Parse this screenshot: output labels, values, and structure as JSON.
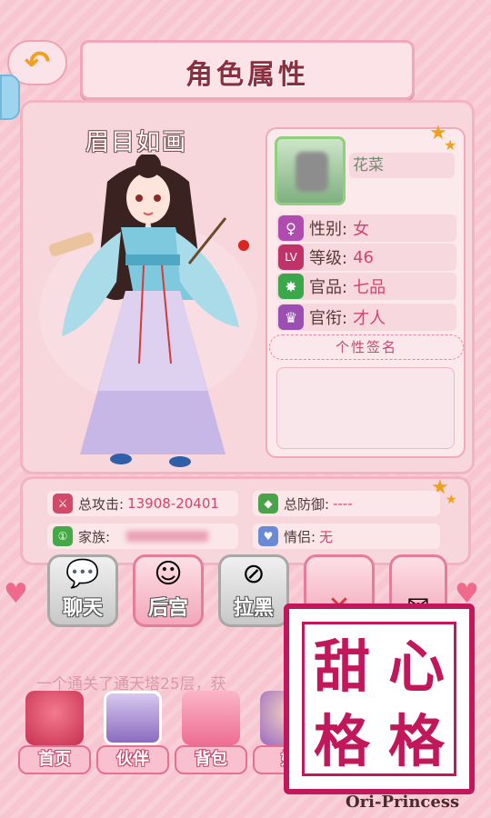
{
  "header": {
    "title": "角色属性"
  },
  "character": {
    "name": "眉目如画"
  },
  "profile": {
    "nickname": "花菜",
    "gender_label": "性别:",
    "gender_value": "女",
    "level_label": "等级:",
    "level_value": "46",
    "rank_label": "官品:",
    "rank_value": "七品",
    "title_label": "官衔:",
    "title_value": "才人",
    "signature_header": "个性签名",
    "signature": ""
  },
  "stats": {
    "attack_label": "总攻击:",
    "attack_value": "13908-20401",
    "defense_label": "总防御:",
    "defense_value": "----",
    "family_label": "家族:",
    "family_value": "",
    "partner_label": "情侣:",
    "partner_value": "无"
  },
  "actions": [
    {
      "label": "聊天"
    },
    {
      "label": "后宫"
    },
    {
      "label": "拉黑"
    }
  ],
  "marquee": "一个通关了通天塔25层，获",
  "bottom_nav": [
    {
      "label": "首页"
    },
    {
      "label": "伙伴"
    },
    {
      "label": "背包"
    },
    {
      "label": "好"
    }
  ],
  "watermark": {
    "chars": [
      "甜",
      "心",
      "格",
      "格"
    ],
    "subtitle": "Ori-Princess"
  },
  "colors": {
    "accent": "#d2446b",
    "panel": "#f7d6dc",
    "logo": "#c2185b"
  }
}
